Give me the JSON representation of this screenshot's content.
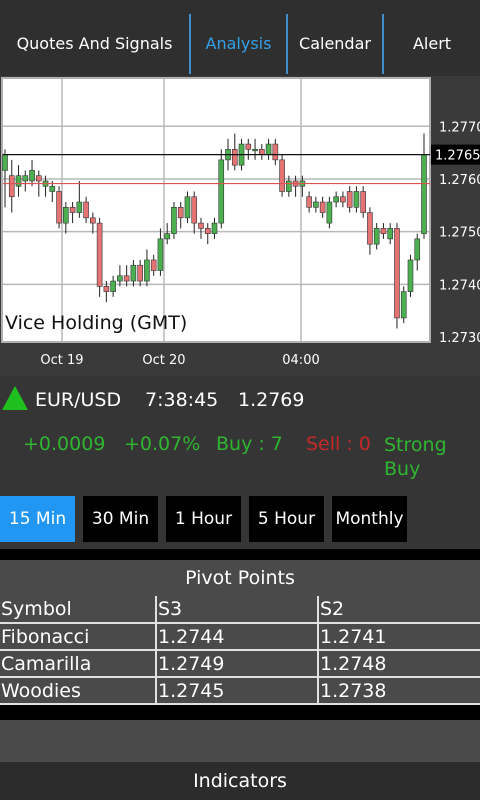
{
  "tabs": [
    {
      "label": "Quotes And Signals"
    },
    {
      "label": "Analysis"
    },
    {
      "label": "Calendar"
    },
    {
      "label": "Alert"
    }
  ],
  "chart_data": {
    "type": "candlestick",
    "title": "Vice Holding (GMT)",
    "x_tick_labels": [
      "Oct 19",
      "Oct 20",
      "04:00"
    ],
    "y_tick_labels": [
      "1.2770",
      "1.2760",
      "1.2750",
      "1.2740",
      "1.2730"
    ],
    "ylim": [
      1.273,
      1.2771
    ],
    "current_price_label": "1.2765",
    "current_price": 1.2765,
    "reference_line": 1.27595,
    "up_color": "#4caf50",
    "down_color": "#e57373",
    "reference_color": "#d9534f",
    "candles": [
      {
        "o": 1.2762,
        "c": 1.2765,
        "h": 1.2766,
        "l": 1.2755
      },
      {
        "o": 1.2761,
        "c": 1.2757,
        "h": 1.2764,
        "l": 1.2754
      },
      {
        "o": 1.2759,
        "c": 1.2761,
        "h": 1.2763,
        "l": 1.2757
      },
      {
        "o": 1.276,
        "c": 1.2761,
        "h": 1.2762,
        "l": 1.2758
      },
      {
        "o": 1.276,
        "c": 1.2762,
        "h": 1.2764,
        "l": 1.2759
      },
      {
        "o": 1.2761,
        "c": 1.276,
        "h": 1.2762,
        "l": 1.2757
      },
      {
        "o": 1.2759,
        "c": 1.276,
        "h": 1.2761,
        "l": 1.2757
      },
      {
        "o": 1.2758,
        "c": 1.2759,
        "h": 1.276,
        "l": 1.2756
      },
      {
        "o": 1.2758,
        "c": 1.2752,
        "h": 1.2759,
        "l": 1.2751
      },
      {
        "o": 1.2752,
        "c": 1.2755,
        "h": 1.2756,
        "l": 1.275
      },
      {
        "o": 1.2755,
        "c": 1.2754,
        "h": 1.2756,
        "l": 1.2752
      },
      {
        "o": 1.2754,
        "c": 1.2756,
        "h": 1.276,
        "l": 1.2753
      },
      {
        "o": 1.2756,
        "c": 1.2753,
        "h": 1.2757,
        "l": 1.2752
      },
      {
        "o": 1.2753,
        "c": 1.2752,
        "h": 1.2754,
        "l": 1.275
      },
      {
        "o": 1.2752,
        "c": 1.274,
        "h": 1.2753,
        "l": 1.2738
      },
      {
        "o": 1.274,
        "c": 1.2739,
        "h": 1.2741,
        "l": 1.2737
      },
      {
        "o": 1.2739,
        "c": 1.2741,
        "h": 1.2742,
        "l": 1.2738
      },
      {
        "o": 1.2741,
        "c": 1.2742,
        "h": 1.2744,
        "l": 1.274
      },
      {
        "o": 1.2742,
        "c": 1.2741,
        "h": 1.2744,
        "l": 1.274
      },
      {
        "o": 1.2741,
        "c": 1.2744,
        "h": 1.2745,
        "l": 1.274
      },
      {
        "o": 1.2744,
        "c": 1.2741,
        "h": 1.2745,
        "l": 1.274
      },
      {
        "o": 1.2741,
        "c": 1.2745,
        "h": 1.2747,
        "l": 1.274
      },
      {
        "o": 1.2745,
        "c": 1.2743,
        "h": 1.2746,
        "l": 1.2742
      },
      {
        "o": 1.2743,
        "c": 1.2749,
        "h": 1.2751,
        "l": 1.2742
      },
      {
        "o": 1.2749,
        "c": 1.275,
        "h": 1.2752,
        "l": 1.2748
      },
      {
        "o": 1.275,
        "c": 1.2755,
        "h": 1.2756,
        "l": 1.2749
      },
      {
        "o": 1.2755,
        "c": 1.2753,
        "h": 1.2756,
        "l": 1.2751
      },
      {
        "o": 1.2753,
        "c": 1.2757,
        "h": 1.2758,
        "l": 1.2752
      },
      {
        "o": 1.2757,
        "c": 1.2752,
        "h": 1.2758,
        "l": 1.275
      },
      {
        "o": 1.2752,
        "c": 1.2751,
        "h": 1.2753,
        "l": 1.2749
      },
      {
        "o": 1.2751,
        "c": 1.275,
        "h": 1.2752,
        "l": 1.2748
      },
      {
        "o": 1.275,
        "c": 1.2752,
        "h": 1.2753,
        "l": 1.2749
      },
      {
        "o": 1.2752,
        "c": 1.2764,
        "h": 1.2766,
        "l": 1.2751
      },
      {
        "o": 1.2764,
        "c": 1.2766,
        "h": 1.2768,
        "l": 1.2762
      },
      {
        "o": 1.2766,
        "c": 1.2763,
        "h": 1.2769,
        "l": 1.2762
      },
      {
        "o": 1.2763,
        "c": 1.2767,
        "h": 1.2768,
        "l": 1.2762
      },
      {
        "o": 1.2767,
        "c": 1.2766,
        "h": 1.2768,
        "l": 1.2764
      },
      {
        "o": 1.2766,
        "c": 1.2766,
        "h": 1.2768,
        "l": 1.2764
      },
      {
        "o": 1.2766,
        "c": 1.2765,
        "h": 1.2767,
        "l": 1.2764
      },
      {
        "o": 1.2765,
        "c": 1.2767,
        "h": 1.2768,
        "l": 1.2764
      },
      {
        "o": 1.2767,
        "c": 1.2764,
        "h": 1.2768,
        "l": 1.2763
      },
      {
        "o": 1.2764,
        "c": 1.2758,
        "h": 1.2765,
        "l": 1.2757
      },
      {
        "o": 1.2758,
        "c": 1.276,
        "h": 1.2761,
        "l": 1.2757
      },
      {
        "o": 1.276,
        "c": 1.2759,
        "h": 1.2761,
        "l": 1.2757
      },
      {
        "o": 1.2759,
        "c": 1.276,
        "h": 1.2761,
        "l": 1.2757
      },
      {
        "o": 1.2757,
        "c": 1.2755,
        "h": 1.2758,
        "l": 1.2754
      },
      {
        "o": 1.2755,
        "c": 1.2756,
        "h": 1.2757,
        "l": 1.2754
      },
      {
        "o": 1.2756,
        "c": 1.2754,
        "h": 1.2757,
        "l": 1.2753
      },
      {
        "o": 1.2752,
        "c": 1.2756,
        "h": 1.2757,
        "l": 1.2751
      },
      {
        "o": 1.2756,
        "c": 1.2757,
        "h": 1.2758,
        "l": 1.2755
      },
      {
        "o": 1.2757,
        "c": 1.2756,
        "h": 1.2758,
        "l": 1.2755
      },
      {
        "o": 1.2758,
        "c": 1.2755,
        "h": 1.2759,
        "l": 1.2754
      },
      {
        "o": 1.2755,
        "c": 1.2758,
        "h": 1.2759,
        "l": 1.2754
      },
      {
        "o": 1.2758,
        "c": 1.2754,
        "h": 1.2759,
        "l": 1.2753
      },
      {
        "o": 1.2754,
        "c": 1.2748,
        "h": 1.2755,
        "l": 1.2746
      },
      {
        "o": 1.2748,
        "c": 1.2751,
        "h": 1.2752,
        "l": 1.2747
      },
      {
        "o": 1.2751,
        "c": 1.275,
        "h": 1.2752,
        "l": 1.2749
      },
      {
        "o": 1.2749,
        "c": 1.2751,
        "h": 1.2752,
        "l": 1.2748
      },
      {
        "o": 1.2751,
        "c": 1.2734,
        "h": 1.2752,
        "l": 1.2732
      },
      {
        "o": 1.2734,
        "c": 1.2739,
        "h": 1.274,
        "l": 1.2733
      },
      {
        "o": 1.2739,
        "c": 1.2745,
        "h": 1.2746,
        "l": 1.2738
      },
      {
        "o": 1.2745,
        "c": 1.2749,
        "h": 1.275,
        "l": 1.2743
      },
      {
        "o": 1.275,
        "c": 1.2765,
        "h": 1.2769,
        "l": 1.2749
      }
    ]
  },
  "quote": {
    "symbol": "EUR/USD",
    "time": "7:38:45",
    "price": "1.2769",
    "change": "+0.0009",
    "change_pct": "+0.07%",
    "buy": "Buy : 7",
    "sell": "Sell : 0",
    "signal_line1": "Strong",
    "signal_line2": "Buy"
  },
  "intervals": [
    {
      "label": "15 Min"
    },
    {
      "label": "30 Min"
    },
    {
      "label": "1 Hour"
    },
    {
      "label": "5 Hour"
    },
    {
      "label": "Monthly"
    }
  ],
  "pivot": {
    "title": "Pivot Points",
    "headers": [
      "Symbol",
      "S3",
      "S2"
    ],
    "rows": [
      [
        "Fibonacci",
        "1.2744",
        "1.2741"
      ],
      [
        "Camarilla",
        "1.2749",
        "1.2748"
      ],
      [
        "Woodies",
        "1.2745",
        "1.2738"
      ]
    ]
  },
  "indicators": {
    "title": "Indicators"
  }
}
